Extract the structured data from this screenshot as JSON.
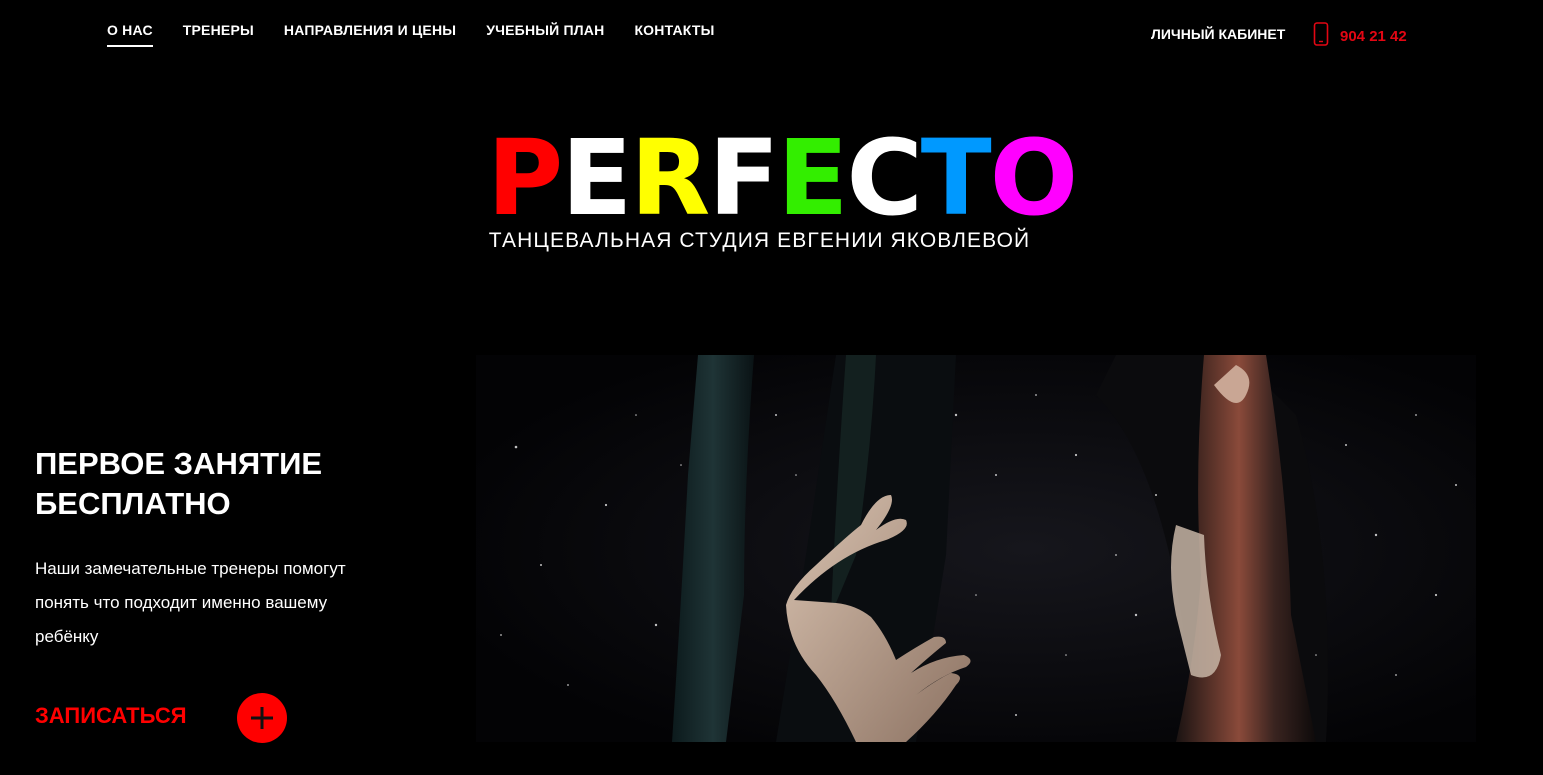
{
  "nav": {
    "items": [
      {
        "label": "О НАС",
        "active": true
      },
      {
        "label": "ТРЕНЕРЫ",
        "active": false
      },
      {
        "label": "НАПРАВЛЕНИЯ И ЦЕНЫ",
        "active": false
      },
      {
        "label": "УЧЕБНЫЙ ПЛАН",
        "active": false
      },
      {
        "label": "КОНТАКТЫ",
        "active": false
      }
    ],
    "cabinet_label": "ЛИЧНЫЙ КАБИНЕТ",
    "phone": "904 21 42",
    "phone_icon": "phone-icon"
  },
  "logo": {
    "letters": [
      {
        "char": "P",
        "color": "#ff0000"
      },
      {
        "char": "E",
        "color": "#ffffff"
      },
      {
        "char": "R",
        "color": "#ffff00"
      },
      {
        "char": "F",
        "color": "#ffffff"
      },
      {
        "char": "E",
        "color": "#33ee00"
      },
      {
        "char": "C",
        "color": "#ffffff"
      },
      {
        "char": "T",
        "color": "#0099ff"
      },
      {
        "char": "O",
        "color": "#ff00ff"
      }
    ],
    "subtitle": "ТАНЦЕВАЛЬНАЯ СТУДИЯ ЕВГЕНИИ ЯКОВЛЕВОЙ"
  },
  "hero": {
    "title_line1": "ПЕРВОЕ ЗАНЯТИЕ",
    "title_line2": "БЕСПЛАТНО",
    "desc_line1": "Наши замечательные тренеры помогут",
    "desc_line2": "понять что подходит именно вашему",
    "desc_line3": "ребёнку",
    "signup_label": "ЗАПИСАТЬСЯ",
    "plus_icon": "plus-icon"
  },
  "colors": {
    "accent": "#ff0000",
    "phone": "#e30613",
    "background": "#000000"
  }
}
